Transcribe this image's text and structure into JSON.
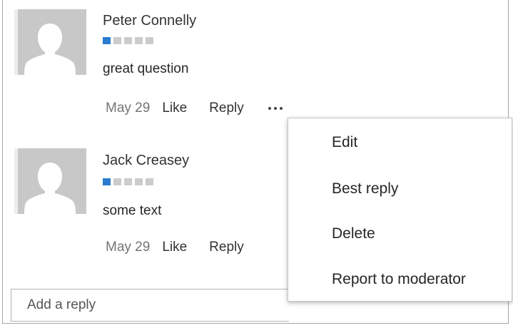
{
  "posts": [
    {
      "author": "Peter Connelly",
      "rank": {
        "filled": 1,
        "total": 5
      },
      "text": "great question",
      "date": "May 29",
      "like_label": "Like",
      "reply_label": "Reply"
    },
    {
      "author": "Jack Creasey",
      "rank": {
        "filled": 1,
        "total": 5
      },
      "text": "some text",
      "date": "May 29",
      "like_label": "Like",
      "reply_label": "Reply"
    }
  ],
  "reply_box": {
    "placeholder": "Add a reply"
  },
  "more_menu": {
    "items": [
      "Edit",
      "Best reply",
      "Delete",
      "Report to moderator"
    ]
  },
  "colors": {
    "rank_on": "#2b7ccf",
    "rank_off": "#cccccc",
    "avatar_bg": "#c8c8c8"
  },
  "icons": {
    "avatar": "person-silhouette-icon",
    "more": "ellipsis-icon"
  }
}
